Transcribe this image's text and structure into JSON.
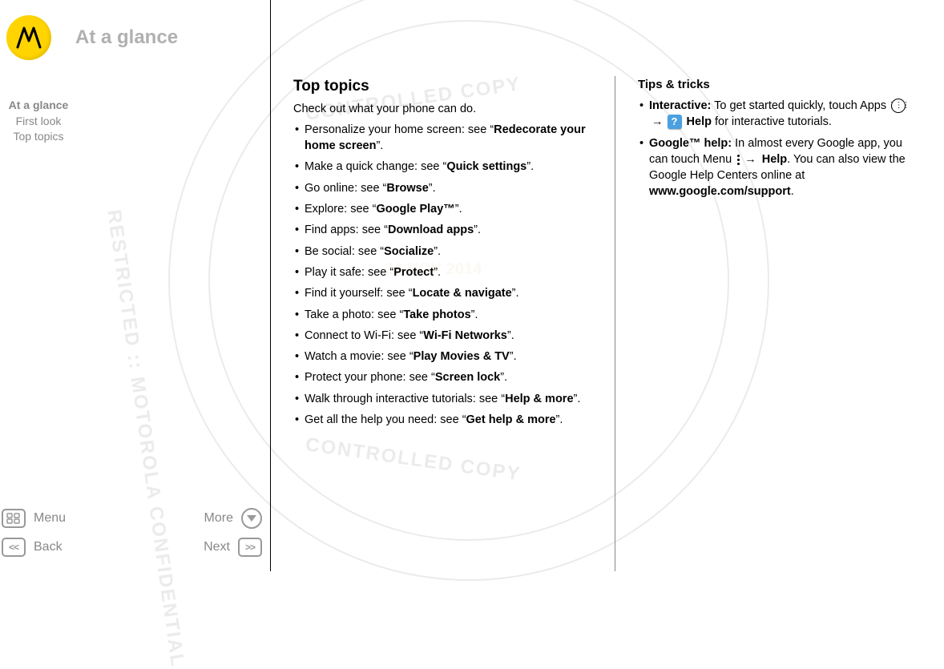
{
  "header": {
    "title": "At a glance"
  },
  "watermark": {
    "text": "RESTRICTED :: MOTOROLA CONFIDENTIAL",
    "curved1": "CONTROLLED COPY",
    "curved2": "CONTROLLED COPY",
    "date": "24 NOV 2014"
  },
  "toc": {
    "items": [
      {
        "label": "At a glance",
        "current": true
      },
      {
        "label": "First look",
        "current": false
      },
      {
        "label": "Top topics",
        "current": false
      }
    ]
  },
  "nav": {
    "menu": "Menu",
    "more": "More",
    "back": "Back",
    "next": "Next"
  },
  "main": {
    "heading": "Top topics",
    "intro": "Check out what your phone can do.",
    "items": [
      {
        "pre": "Personalize your home screen: see “",
        "link": "Redecorate your home screen",
        "post": "”."
      },
      {
        "pre": "Make a quick change: see “",
        "link": "Quick settings",
        "post": "”."
      },
      {
        "pre": "Go online: see “",
        "link": "Browse",
        "post": "”."
      },
      {
        "pre": "Explore: see “",
        "link": "Google Play™",
        "post": "”."
      },
      {
        "pre": "Find apps: see “",
        "link": "Download apps",
        "post": "”."
      },
      {
        "pre": "Be social: see “",
        "link": "Socialize",
        "post": "”."
      },
      {
        "pre": "Play it safe: see “",
        "link": "Protect",
        "post": "”."
      },
      {
        "pre": "Find it yourself: see “",
        "link": "Locate & navigate",
        "post": "”."
      },
      {
        "pre": "Take a photo: see “",
        "link": "Take photos",
        "post": "”."
      },
      {
        "pre": "Connect to Wi-Fi: see “",
        "link": "Wi-Fi Networks",
        "post": "”."
      },
      {
        "pre": "Watch a movie: see “",
        "link": "Play Movies & TV",
        "post": "”."
      },
      {
        "pre": "Protect your phone: see “",
        "link": "Screen lock",
        "post": "”."
      },
      {
        "pre": "Walk through interactive tutorials: see “",
        "link": "Help & more",
        "post": "”."
      },
      {
        "pre": "Get all the help you need: see “",
        "link": "Get help & more",
        "post": "”."
      }
    ]
  },
  "tips": {
    "heading": "Tips & tricks",
    "item1": {
      "lead": "Interactive:",
      "text1": " To get started quickly, touch Apps ",
      "arrow": "→",
      "help_label": " Help",
      "text2": " for interactive tutorials."
    },
    "item2": {
      "lead": "Google™ help:",
      "text1": " In almost every Google app, you can touch Menu ",
      "arrow": "→",
      "help_word": " Help",
      "text2": ". You can also view the Google Help Centers online at ",
      "url": "www.google.com/support",
      "text3": "."
    }
  }
}
